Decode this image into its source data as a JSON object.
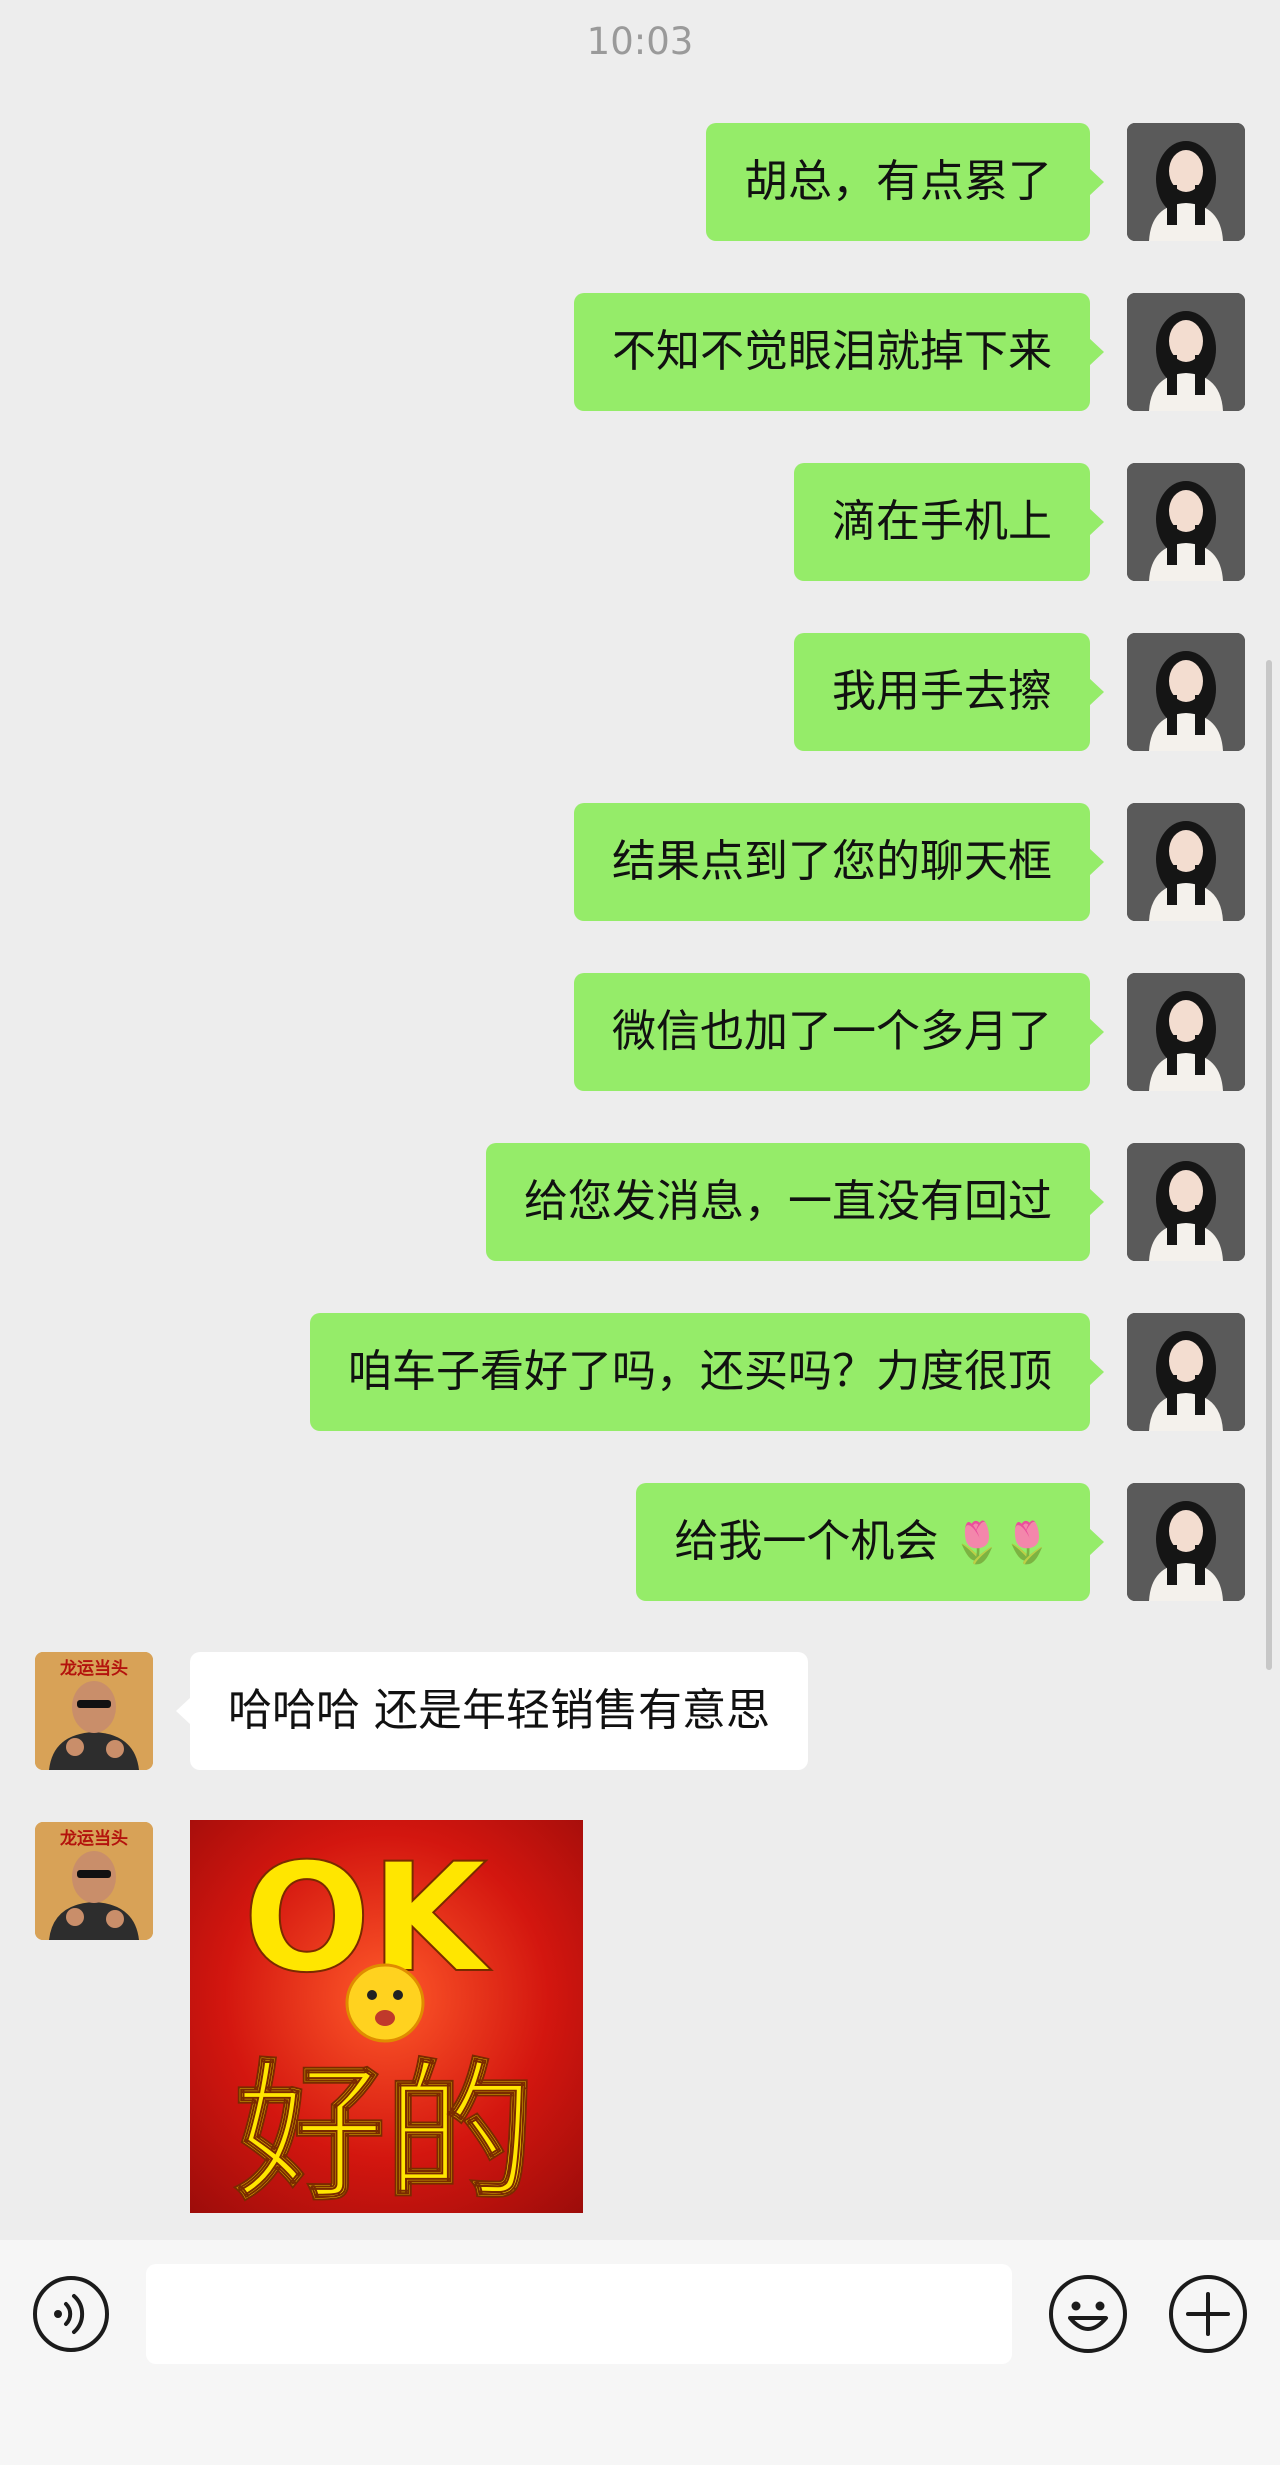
{
  "status": {
    "time": "10:03"
  },
  "messages": [
    {
      "from": "me",
      "text": "胡总，有点累了"
    },
    {
      "from": "me",
      "text": "不知不觉眼泪就掉下来"
    },
    {
      "from": "me",
      "text": "滴在手机上"
    },
    {
      "from": "me",
      "text": "我用手去擦"
    },
    {
      "from": "me",
      "text": "结果点到了您的聊天框"
    },
    {
      "from": "me",
      "text": "微信也加了一个多月了"
    },
    {
      "from": "me",
      "text": "给您发消息，一直没有回过"
    },
    {
      "from": "me",
      "text": "咱车子看好了吗，还买吗？力度很顶"
    },
    {
      "from": "me",
      "text": "给我一个机会",
      "emoji": "🌷🌷"
    },
    {
      "from": "them",
      "text": "哈哈哈 还是年轻销售有意思"
    }
  ],
  "contact_avatar": {
    "text": "龙运当头"
  },
  "sticker": {
    "line1": "OK",
    "line2": "好的",
    "background": "#c9140f",
    "text_color": "#ffe600"
  },
  "input": {
    "value": ""
  },
  "icons": {
    "voice": "voice-icon",
    "emoji": "emoji-icon",
    "plus": "plus-icon"
  },
  "colors": {
    "my_bubble": "#95ec69",
    "their_bubble": "#ffffff",
    "background": "#ededed"
  }
}
